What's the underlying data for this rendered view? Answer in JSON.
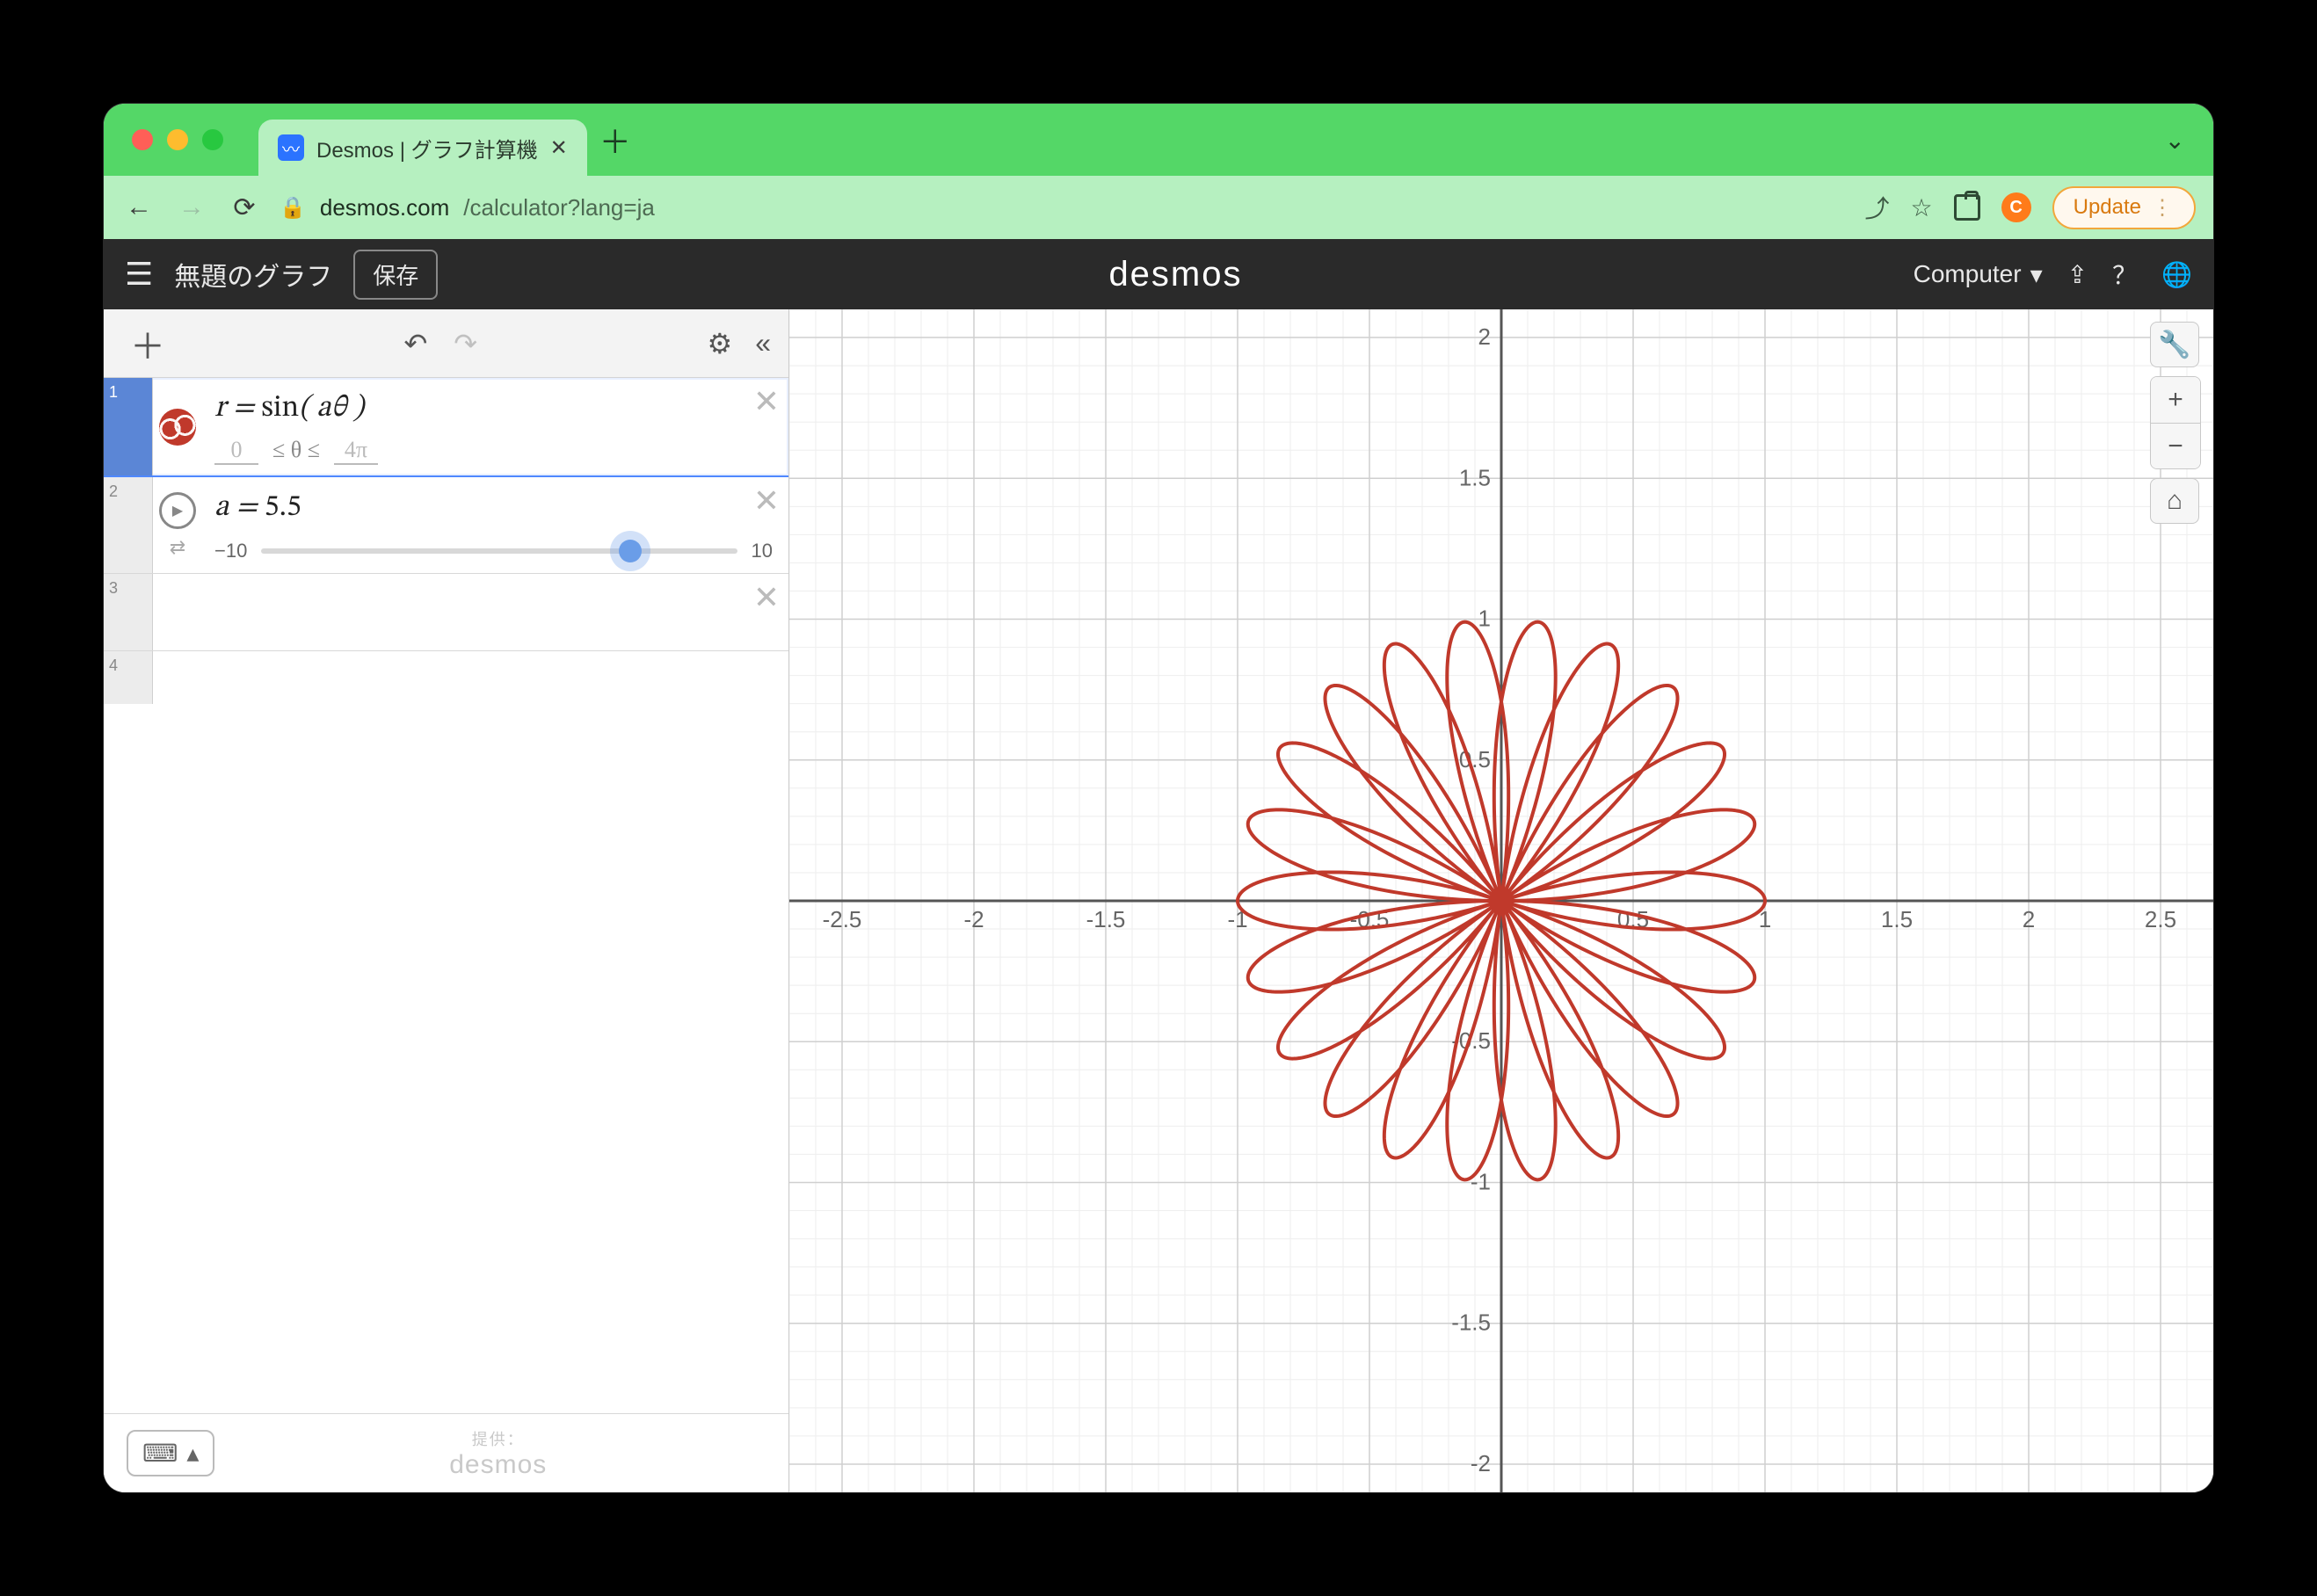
{
  "browser": {
    "tab_title": "Desmos | グラフ計算機",
    "url_host": "desmos.com",
    "url_path": "/calculator?lang=ja",
    "update_label": "Update",
    "profile_initial": "C"
  },
  "header": {
    "graph_title": "無題のグラフ",
    "save_label": "保存",
    "brand": "desmos",
    "language_label": "Computer"
  },
  "sidebar": {
    "rows": {
      "1": {
        "index": "1",
        "expr_html": "r = sin( aθ )",
        "domain_low": "0",
        "domain_mid": "≤ θ ≤",
        "domain_high": "4π"
      },
      "2": {
        "index": "2",
        "expr_html": "a = 5.5",
        "slider_min": "−10",
        "slider_max": "10",
        "slider_pos_pct": 77.5
      },
      "3": {
        "index": "3"
      },
      "4": {
        "index": "4"
      }
    },
    "footer": {
      "provided_label": "提供：",
      "provided_brand": "desmos"
    }
  },
  "graph_controls": {
    "wrench": "🔧",
    "plus": "+",
    "minus": "−",
    "home": "⌂"
  },
  "chart_data": {
    "type": "line",
    "title": "",
    "coords": "polar-on-cartesian",
    "equation": "r = sin(a·θ)",
    "parameters": {
      "a": 5.5
    },
    "theta_range_hint": [
      0,
      12.566
    ],
    "xlim": [
      -2.7,
      2.7
    ],
    "ylim": [
      -2.1,
      2.1
    ],
    "x_ticks": [
      -2.5,
      -2,
      -1.5,
      -1,
      -0.5,
      0.5,
      1,
      1.5,
      2,
      2.5
    ],
    "y_ticks": [
      -2,
      -1.5,
      -1,
      -0.5,
      0.5,
      1,
      1.5,
      2
    ],
    "grid": true,
    "stroke_color": "#c0392b",
    "xlabel": "",
    "ylabel": ""
  }
}
